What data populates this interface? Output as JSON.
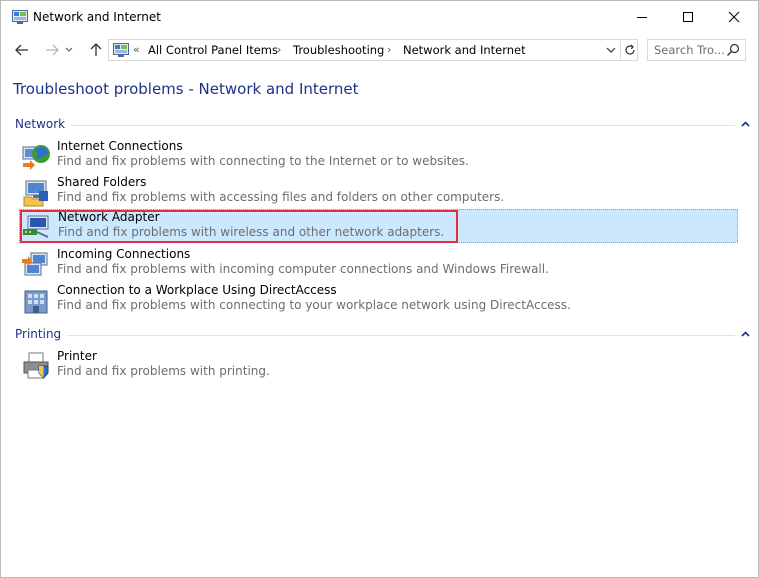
{
  "window": {
    "title": "Network and Internet"
  },
  "address_bar": {
    "overflow": "«",
    "crumbs": [
      "All Control Panel Items",
      "Troubleshooting",
      "Network and Internet"
    ],
    "separator": "›"
  },
  "search": {
    "placeholder": "Search Tro..."
  },
  "page": {
    "title": "Troubleshoot problems - Network and Internet"
  },
  "groups": [
    {
      "label": "Network",
      "items": [
        {
          "title": "Internet Connections",
          "desc": "Find and fix problems with connecting to the Internet or to websites."
        },
        {
          "title": "Shared Folders",
          "desc": "Find and fix problems with accessing files and folders on other computers."
        },
        {
          "title": "Network Adapter",
          "desc": "Find and fix problems with wireless and other network adapters."
        },
        {
          "title": "Incoming Connections",
          "desc": "Find and fix problems with incoming computer connections and Windows Firewall."
        },
        {
          "title": "Connection to a Workplace Using DirectAccess",
          "desc": "Find and fix problems with connecting to your workplace network using DirectAccess."
        }
      ]
    },
    {
      "label": "Printing",
      "items": [
        {
          "title": "Printer",
          "desc": "Find and fix problems with printing."
        }
      ]
    }
  ],
  "selected_item": "Network Adapter",
  "colors": {
    "link_blue": "#1e3287",
    "selection_bg": "#cce8ff",
    "highlight_red": "#e52d3d",
    "desc_gray": "#6d6d6d"
  }
}
